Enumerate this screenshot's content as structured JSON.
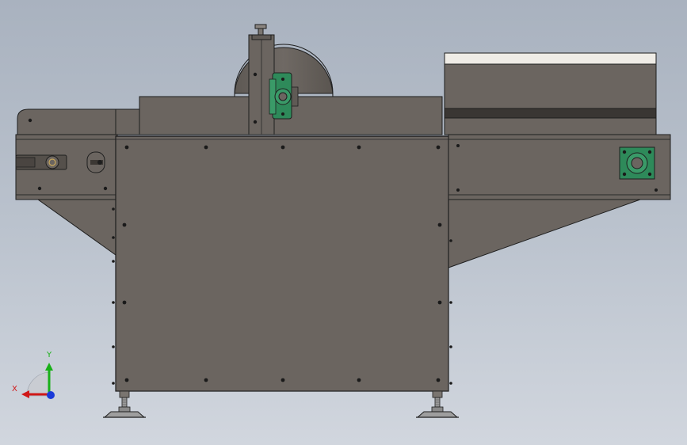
{
  "triad": {
    "x_label": "X",
    "y_label": "Y",
    "x_color": "#d01818",
    "y_color": "#18b018",
    "z_color": "#1a3ad8"
  },
  "colors": {
    "background_top": "#a9b2bf",
    "background_bottom": "#d1d6de",
    "body": "#6b6560",
    "body_dark": "#5a5550",
    "edge": "#1e1e1e",
    "bearing_green": "#2e8a5a",
    "belt_dark": "#3a3633",
    "top_cover": "#efece6",
    "leveling_foot": "#8a8a8a"
  }
}
